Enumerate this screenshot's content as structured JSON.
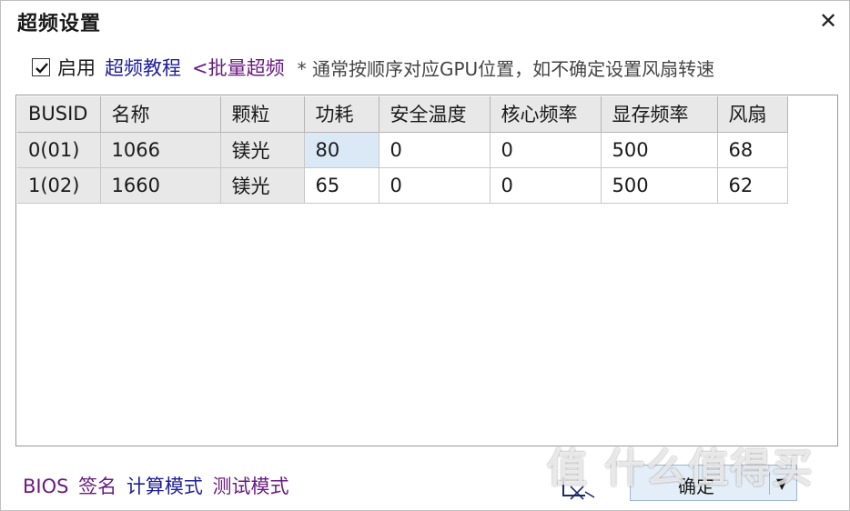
{
  "window": {
    "title": "超频设置"
  },
  "options": {
    "enable_checked": true,
    "enable_label": "启用",
    "tutorial_link": "超频教程",
    "batch_link": "<批量超频",
    "note": "* 通常按顺序对应GPU位置，如不确定设置风扇转速"
  },
  "table": {
    "headers": [
      "BUSID",
      "名称",
      "颗粒",
      "功耗",
      "安全温度",
      "核心频率",
      "显存频率",
      "风扇"
    ],
    "rows": [
      [
        "0(01)",
        "1066",
        "镁光",
        "80",
        "0",
        "0",
        "500",
        "68"
      ],
      [
        "1(02)",
        "1660",
        "镁光",
        "65",
        "0",
        "0",
        "500",
        "62"
      ]
    ],
    "selected_cell": "0(01) / 功耗"
  },
  "footer": {
    "bios": "BIOS",
    "sign": "签名",
    "calc_mode": "计算模式",
    "test_mode": "测试模式",
    "ok_button": "确定",
    "ok_dropdown_icon": "caret-down-icon"
  },
  "watermark": "值 什么值得买",
  "colors": {
    "link_blue": "#1f1f9c",
    "link_purple": "#6a1b80",
    "selected_cell": "#dbe9f6",
    "header_bg": "#e8e8e8",
    "button_bg": "#e4eef8"
  }
}
